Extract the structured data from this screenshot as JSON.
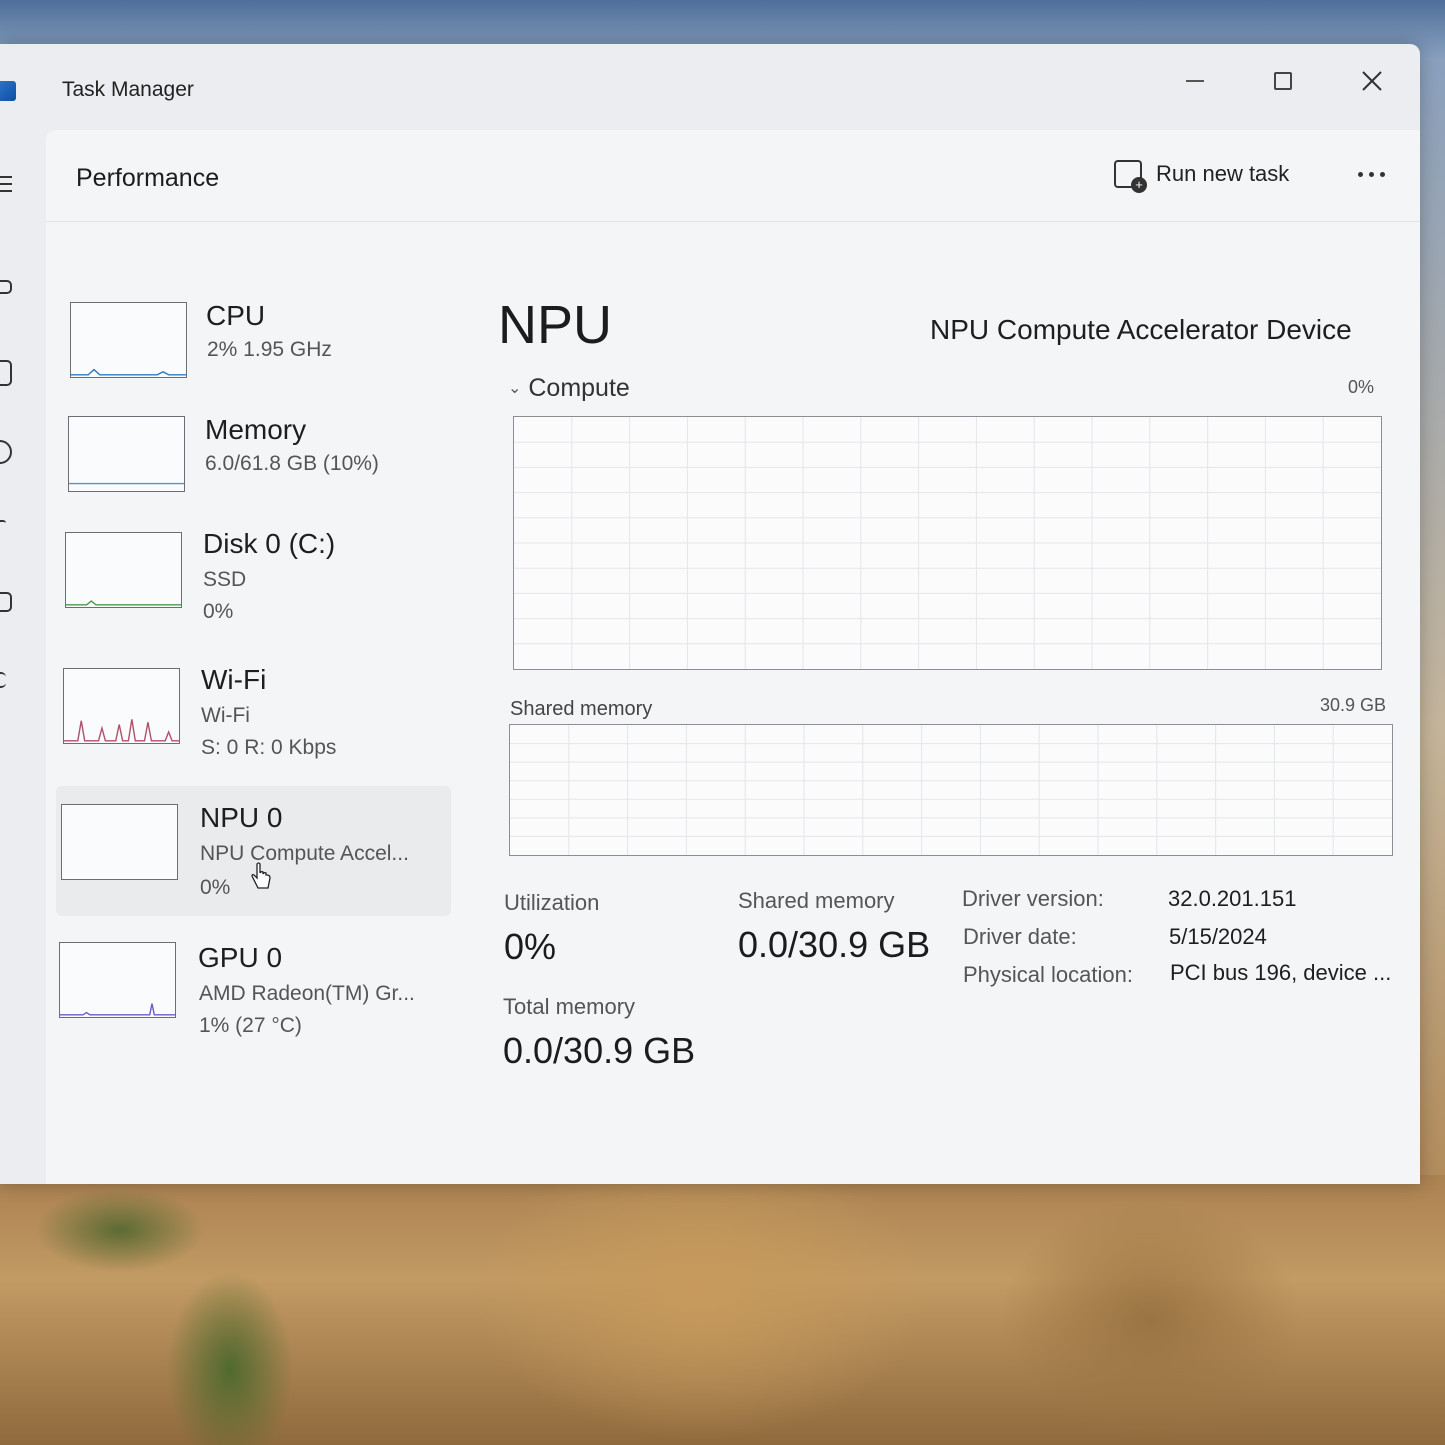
{
  "window": {
    "title": "Task Manager"
  },
  "header": {
    "page_title": "Performance",
    "run_task_label": "Run new task"
  },
  "resources": [
    {
      "name": "CPU",
      "line1": "2%  1.95 GHz",
      "line2": "",
      "graph_color": "#2f7bc4"
    },
    {
      "name": "Memory",
      "line1": "6.0/61.8 GB (10%)",
      "line2": "",
      "graph_color": "#5a8fd0"
    },
    {
      "name": "Disk 0 (C:)",
      "line1": "SSD",
      "line2": "0%",
      "graph_color": "#4c9a4c"
    },
    {
      "name": "Wi-Fi",
      "line1": "Wi-Fi",
      "line2": "S: 0 R: 0 Kbps",
      "graph_color": "#b0506a"
    },
    {
      "name": "NPU 0",
      "line1": "NPU Compute Accel...",
      "line2": "0%",
      "graph_color": "#2f7bc4"
    },
    {
      "name": "GPU 0",
      "line1": "AMD Radeon(TM) Gr...",
      "line2": "1%  (27 °C)",
      "graph_color": "#6a5acd"
    }
  ],
  "detail": {
    "title": "NPU",
    "device_name": "NPU Compute Accelerator Device",
    "compute_label": "Compute",
    "compute_max": "0%",
    "shared_memory_label": "Shared memory",
    "shared_memory_max": "30.9 GB",
    "stats": {
      "utilization_label": "Utilization",
      "utilization_value": "0%",
      "shared_memory_label": "Shared memory",
      "shared_memory_value": "0.0/30.9 GB",
      "total_memory_label": "Total memory",
      "total_memory_value": "0.0/30.9 GB"
    },
    "info": {
      "driver_version_label": "Driver version:",
      "driver_version_value": "32.0.201.151",
      "driver_date_label": "Driver date:",
      "driver_date_value": "5/15/2024",
      "physical_location_label": "Physical location:",
      "physical_location_value": "PCI bus 196, device ..."
    }
  },
  "colors": {
    "accent": "#2f7bc4",
    "grid_line": "#e3e6ea",
    "graph_border": "#8a8f95"
  }
}
